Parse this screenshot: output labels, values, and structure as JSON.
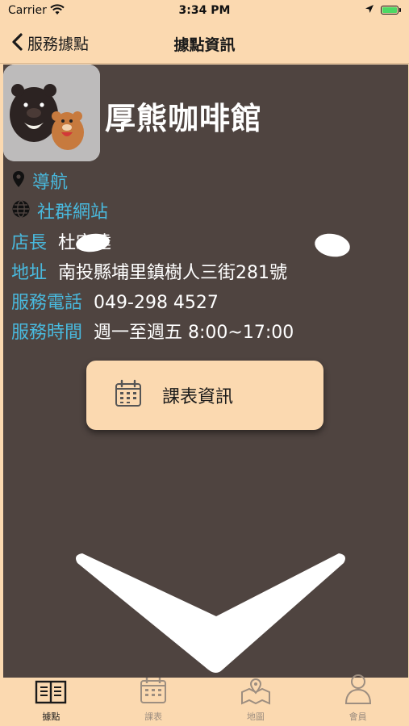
{
  "status_bar": {
    "carrier": "Carrier",
    "time": "3:34 PM"
  },
  "nav": {
    "back_label": "服務據點",
    "title": "據點資訊"
  },
  "shop": {
    "name": "厚熊咖啡館",
    "nav_link": "導航",
    "social_link": "社群網站",
    "manager_label": "店長",
    "manager_value": "杜宗達",
    "address_label": "地址",
    "address_value": "南投縣埔里鎮樹人三街281號",
    "phone_label": "服務電話",
    "phone_value": "049-298 4527",
    "hours_label": "服務時間",
    "hours_value": "週一至週五 8:00~17:00"
  },
  "schedule_button": {
    "label": "課表資訊"
  },
  "tabs": [
    {
      "label": "據點",
      "icon": "book-icon",
      "active": true
    },
    {
      "label": "課表",
      "icon": "calendar-icon",
      "active": false
    },
    {
      "label": "地圖",
      "icon": "map-icon",
      "active": false
    },
    {
      "label": "會員",
      "icon": "person-icon",
      "active": false
    }
  ],
  "colors": {
    "accent": "#fbd9b0",
    "content_bg": "#4f4440",
    "link": "#49b9dd",
    "battery": "#4cd964"
  }
}
